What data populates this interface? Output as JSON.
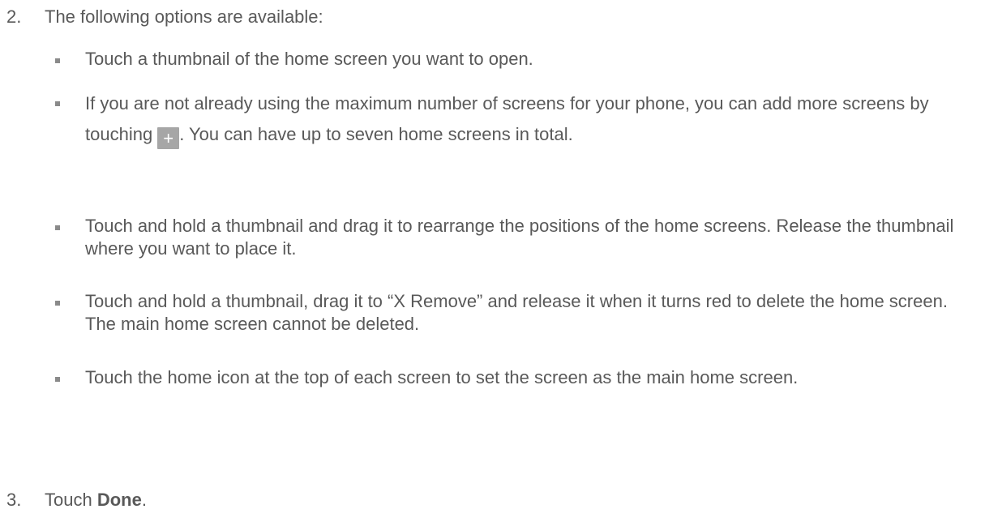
{
  "steps": [
    {
      "number": "2.",
      "text": "The following options are available:"
    },
    {
      "number": "3.",
      "prefix": "Touch ",
      "bold": "Done",
      "suffix": "."
    }
  ],
  "options": [
    {
      "text": "Touch a thumbnail of the home screen you want to open."
    },
    {
      "text_before_icon": "If you are not already using the maximum number of screens for your phone, you can add more screens by touching",
      "icon": "plus-icon",
      "icon_glyph": "+",
      "text_after_icon": ". You can have up to seven home screens in total."
    },
    {
      "text": "Touch and hold a thumbnail and drag it to rearrange the positions of the home screens. Release the thumbnail where you want to place it."
    },
    {
      "text": "Touch and hold a thumbnail, drag it to “X Remove” and release it when it turns red to delete the home screen. The main home screen cannot be deleted."
    },
    {
      "text": "Touch the home icon at the top of each screen to set the screen as the main home screen."
    }
  ],
  "colors": {
    "text": "#595959",
    "bullet": "#8a8a8a",
    "icon_bg": "#a6a6a6"
  }
}
